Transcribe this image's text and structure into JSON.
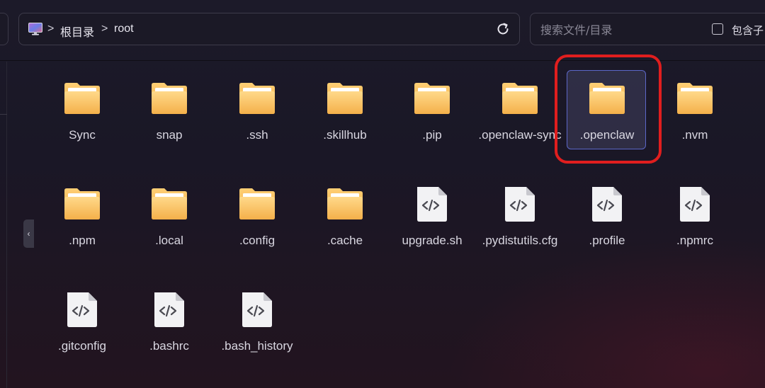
{
  "breadcrumb": {
    "items": [
      "根目录",
      "root"
    ],
    "separator": ">"
  },
  "search": {
    "placeholder": "搜索文件/目录",
    "include_sub_label": "包含子目"
  },
  "files": [
    {
      "name": "Sync",
      "kind": "folder"
    },
    {
      "name": "snap",
      "kind": "folder"
    },
    {
      "name": ".ssh",
      "kind": "folder"
    },
    {
      "name": ".skillhub",
      "kind": "folder"
    },
    {
      "name": ".pip",
      "kind": "folder"
    },
    {
      "name": ".openclaw-sync",
      "kind": "folder"
    },
    {
      "name": ".openclaw",
      "kind": "folder",
      "selected": true
    },
    {
      "name": ".nvm",
      "kind": "folder"
    },
    {
      "name": ".npm",
      "kind": "folder"
    },
    {
      "name": ".local",
      "kind": "folder"
    },
    {
      "name": ".config",
      "kind": "folder"
    },
    {
      "name": ".cache",
      "kind": "folder"
    },
    {
      "name": "upgrade.sh",
      "kind": "code-file"
    },
    {
      "name": ".pydistutils.cfg",
      "kind": "code-file"
    },
    {
      "name": ".profile",
      "kind": "code-file"
    },
    {
      "name": ".npmrc",
      "kind": "code-file"
    },
    {
      "name": ".gitconfig",
      "kind": "code-file"
    },
    {
      "name": ".bashrc",
      "kind": "code-file"
    },
    {
      "name": ".bash_history",
      "kind": "code-file"
    }
  ],
  "colors": {
    "background": "#1c1a29",
    "folder": "#f5b64a",
    "selection_border": "#5c67c8",
    "highlight_ring": "#e01e1e"
  }
}
